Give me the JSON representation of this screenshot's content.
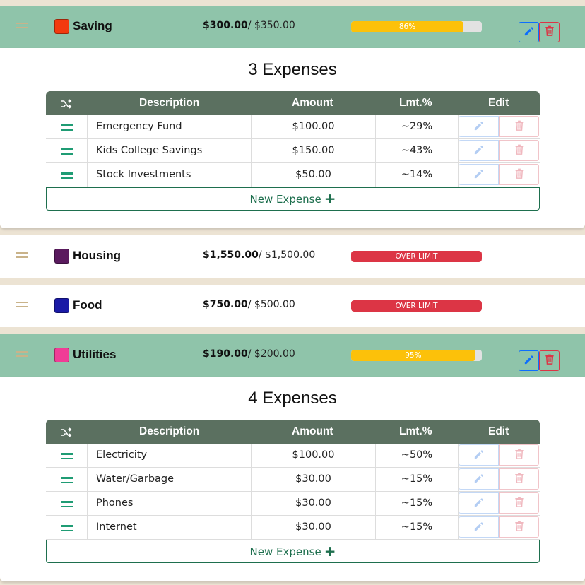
{
  "categories": [
    {
      "name": "Saving",
      "color": "#f33a0e",
      "spent": "$300.00",
      "limit": "/ $350.00",
      "progress_label": "86%",
      "progress": 0.86,
      "status": "ok",
      "expanded": true,
      "expenses_title": "3 Expenses",
      "expenses": [
        {
          "description": "Emergency Fund",
          "amount": "$100.00",
          "pct": "~29%"
        },
        {
          "description": "Kids College Savings",
          "amount": "$150.00",
          "pct": "~43%"
        },
        {
          "description": "Stock Investments",
          "amount": "$50.00",
          "pct": "~14%"
        }
      ]
    },
    {
      "name": "Housing",
      "color": "#5a1a5e",
      "spent": "$1,550.00",
      "limit": "/ $1,500.00",
      "progress_label": "OVER LIMIT",
      "progress": 1.0,
      "status": "over",
      "expanded": false
    },
    {
      "name": "Food",
      "color": "#1a1aa6",
      "spent": "$750.00",
      "limit": "/ $500.00",
      "progress_label": "OVER LIMIT",
      "progress": 1.0,
      "status": "over",
      "expanded": false
    },
    {
      "name": "Utilities",
      "color": "#f03c96",
      "spent": "$190.00",
      "limit": "/ $200.00",
      "progress_label": "95%",
      "progress": 0.95,
      "status": "ok",
      "expanded": true,
      "expenses_title": "4 Expenses",
      "expenses": [
        {
          "description": "Electricity",
          "amount": "$100.00",
          "pct": "~50%"
        },
        {
          "description": "Water/Garbage",
          "amount": "$30.00",
          "pct": "~15%"
        },
        {
          "description": "Phones",
          "amount": "$30.00",
          "pct": "~15%"
        },
        {
          "description": "Internet",
          "amount": "$30.00",
          "pct": "~15%"
        }
      ]
    }
  ],
  "table_headers": {
    "description": "Description",
    "amount": "Amount",
    "pct": "Lmt.%",
    "edit": "Edit"
  },
  "new_expense_label": "New Expense",
  "colors": {
    "header_active": "#8fc4aa",
    "table_header": "#5b7060",
    "accent": "#1e6f4e",
    "warn": "#fcc10a",
    "danger": "#dc3545",
    "primary": "#0d6efd"
  }
}
